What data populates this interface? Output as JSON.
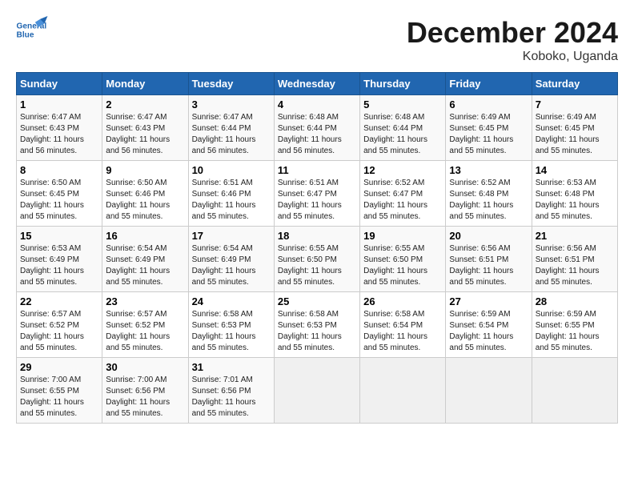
{
  "logo": {
    "line1": "General",
    "line2": "Blue"
  },
  "title": "December 2024",
  "subtitle": "Koboko, Uganda",
  "weekdays": [
    "Sunday",
    "Monday",
    "Tuesday",
    "Wednesday",
    "Thursday",
    "Friday",
    "Saturday"
  ],
  "weeks": [
    [
      {
        "day": "1",
        "sunrise": "6:47 AM",
        "sunset": "6:43 PM",
        "daylight": "11 hours and 56 minutes."
      },
      {
        "day": "2",
        "sunrise": "6:47 AM",
        "sunset": "6:43 PM",
        "daylight": "11 hours and 56 minutes."
      },
      {
        "day": "3",
        "sunrise": "6:47 AM",
        "sunset": "6:44 PM",
        "daylight": "11 hours and 56 minutes."
      },
      {
        "day": "4",
        "sunrise": "6:48 AM",
        "sunset": "6:44 PM",
        "daylight": "11 hours and 56 minutes."
      },
      {
        "day": "5",
        "sunrise": "6:48 AM",
        "sunset": "6:44 PM",
        "daylight": "11 hours and 55 minutes."
      },
      {
        "day": "6",
        "sunrise": "6:49 AM",
        "sunset": "6:45 PM",
        "daylight": "11 hours and 55 minutes."
      },
      {
        "day": "7",
        "sunrise": "6:49 AM",
        "sunset": "6:45 PM",
        "daylight": "11 hours and 55 minutes."
      }
    ],
    [
      {
        "day": "8",
        "sunrise": "6:50 AM",
        "sunset": "6:45 PM",
        "daylight": "11 hours and 55 minutes."
      },
      {
        "day": "9",
        "sunrise": "6:50 AM",
        "sunset": "6:46 PM",
        "daylight": "11 hours and 55 minutes."
      },
      {
        "day": "10",
        "sunrise": "6:51 AM",
        "sunset": "6:46 PM",
        "daylight": "11 hours and 55 minutes."
      },
      {
        "day": "11",
        "sunrise": "6:51 AM",
        "sunset": "6:47 PM",
        "daylight": "11 hours and 55 minutes."
      },
      {
        "day": "12",
        "sunrise": "6:52 AM",
        "sunset": "6:47 PM",
        "daylight": "11 hours and 55 minutes."
      },
      {
        "day": "13",
        "sunrise": "6:52 AM",
        "sunset": "6:48 PM",
        "daylight": "11 hours and 55 minutes."
      },
      {
        "day": "14",
        "sunrise": "6:53 AM",
        "sunset": "6:48 PM",
        "daylight": "11 hours and 55 minutes."
      }
    ],
    [
      {
        "day": "15",
        "sunrise": "6:53 AM",
        "sunset": "6:49 PM",
        "daylight": "11 hours and 55 minutes."
      },
      {
        "day": "16",
        "sunrise": "6:54 AM",
        "sunset": "6:49 PM",
        "daylight": "11 hours and 55 minutes."
      },
      {
        "day": "17",
        "sunrise": "6:54 AM",
        "sunset": "6:49 PM",
        "daylight": "11 hours and 55 minutes."
      },
      {
        "day": "18",
        "sunrise": "6:55 AM",
        "sunset": "6:50 PM",
        "daylight": "11 hours and 55 minutes."
      },
      {
        "day": "19",
        "sunrise": "6:55 AM",
        "sunset": "6:50 PM",
        "daylight": "11 hours and 55 minutes."
      },
      {
        "day": "20",
        "sunrise": "6:56 AM",
        "sunset": "6:51 PM",
        "daylight": "11 hours and 55 minutes."
      },
      {
        "day": "21",
        "sunrise": "6:56 AM",
        "sunset": "6:51 PM",
        "daylight": "11 hours and 55 minutes."
      }
    ],
    [
      {
        "day": "22",
        "sunrise": "6:57 AM",
        "sunset": "6:52 PM",
        "daylight": "11 hours and 55 minutes."
      },
      {
        "day": "23",
        "sunrise": "6:57 AM",
        "sunset": "6:52 PM",
        "daylight": "11 hours and 55 minutes."
      },
      {
        "day": "24",
        "sunrise": "6:58 AM",
        "sunset": "6:53 PM",
        "daylight": "11 hours and 55 minutes."
      },
      {
        "day": "25",
        "sunrise": "6:58 AM",
        "sunset": "6:53 PM",
        "daylight": "11 hours and 55 minutes."
      },
      {
        "day": "26",
        "sunrise": "6:58 AM",
        "sunset": "6:54 PM",
        "daylight": "11 hours and 55 minutes."
      },
      {
        "day": "27",
        "sunrise": "6:59 AM",
        "sunset": "6:54 PM",
        "daylight": "11 hours and 55 minutes."
      },
      {
        "day": "28",
        "sunrise": "6:59 AM",
        "sunset": "6:55 PM",
        "daylight": "11 hours and 55 minutes."
      }
    ],
    [
      {
        "day": "29",
        "sunrise": "7:00 AM",
        "sunset": "6:55 PM",
        "daylight": "11 hours and 55 minutes."
      },
      {
        "day": "30",
        "sunrise": "7:00 AM",
        "sunset": "6:56 PM",
        "daylight": "11 hours and 55 minutes."
      },
      {
        "day": "31",
        "sunrise": "7:01 AM",
        "sunset": "6:56 PM",
        "daylight": "11 hours and 55 minutes."
      },
      null,
      null,
      null,
      null
    ]
  ],
  "labels": {
    "sunrise": "Sunrise:",
    "sunset": "Sunset:",
    "daylight": "Daylight:"
  }
}
